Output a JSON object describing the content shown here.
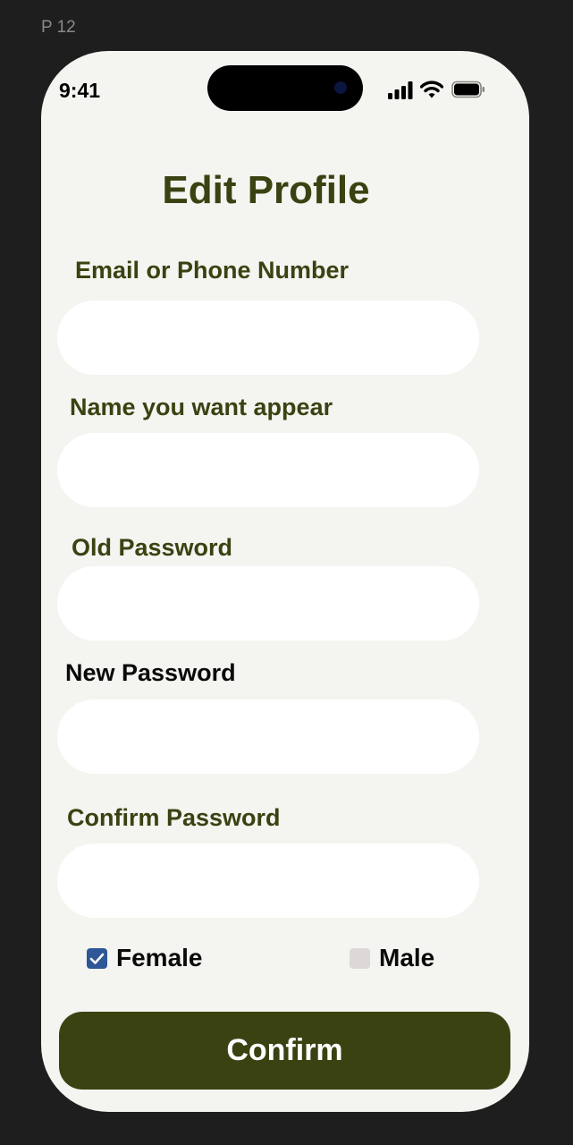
{
  "frame": {
    "label": "P 12"
  },
  "status_bar": {
    "time": "9:41"
  },
  "page": {
    "title": "Edit Profile"
  },
  "fields": [
    {
      "label": "Email or Phone Number",
      "value": "",
      "placeholder": ""
    },
    {
      "label": "Name you want appear",
      "value": "",
      "placeholder": ""
    },
    {
      "label": "Old Password",
      "value": "",
      "placeholder": ""
    },
    {
      "label": "New Password",
      "value": "",
      "placeholder": ""
    },
    {
      "label": "Confirm Password",
      "value": "",
      "placeholder": ""
    }
  ],
  "gender": {
    "options": [
      {
        "label": "Female",
        "checked": true
      },
      {
        "label": "Male",
        "checked": false
      }
    ]
  },
  "actions": {
    "confirm_label": "Confirm"
  },
  "colors": {
    "accent": "#3a4212",
    "background": "#f4f4f0",
    "checkbox_checked": "#2d5796",
    "checkbox_unchecked": "#ddd8d8"
  },
  "icons": [
    "cellular-signal-icon",
    "wifi-icon",
    "battery-icon",
    "checkmark-icon"
  ]
}
